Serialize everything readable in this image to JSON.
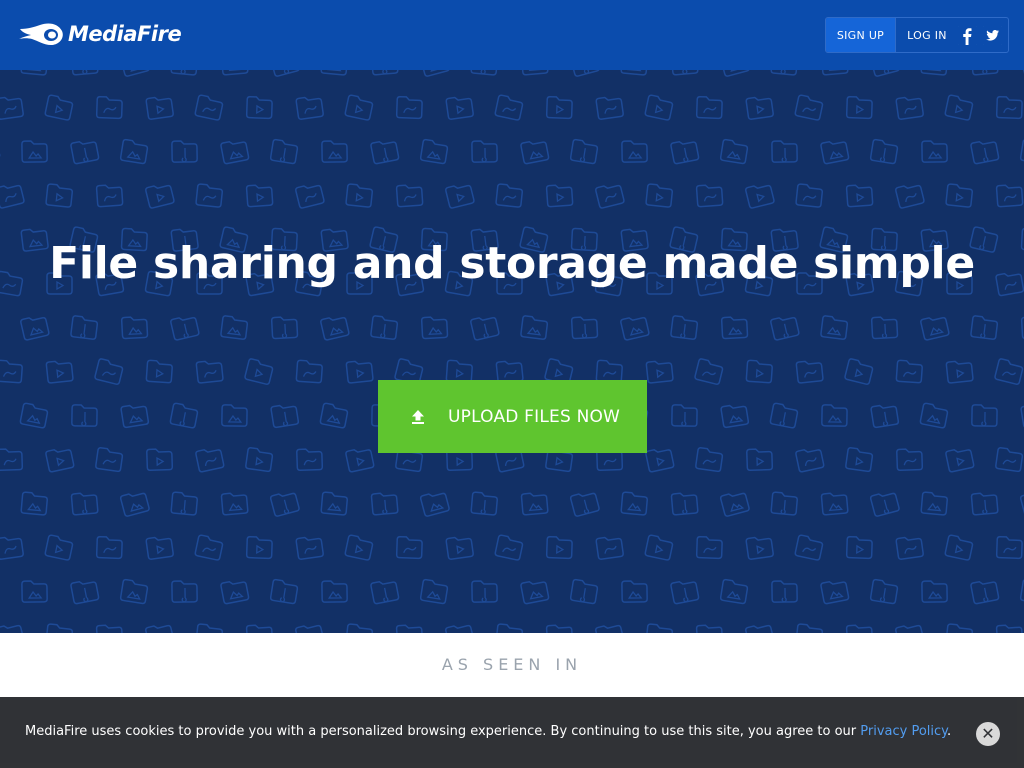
{
  "header": {
    "brand": "MediaFire",
    "signup_label": "SIGN UP",
    "login_label": "LOG IN",
    "social_icons": [
      "facebook-icon",
      "twitter-icon"
    ]
  },
  "hero": {
    "title": "File sharing and storage made simple",
    "upload_label": "UPLOAD FILES NOW",
    "upload_icon": "upload-arrow-icon"
  },
  "press": {
    "title": "AS SEEN IN"
  },
  "cookie": {
    "text": "MediaFire uses cookies to provide you with a personalized browsing experience. By continuing to use this site, you agree to our ",
    "link": "Privacy Policy",
    "end": ".",
    "close_icon": "close-icon"
  },
  "colors": {
    "header_bg": "#0b4cad",
    "hero_bg": "#123066",
    "upload_bg": "#5fc52f",
    "cookie_bg": "#2a2c30",
    "link": "#4d9af0"
  }
}
